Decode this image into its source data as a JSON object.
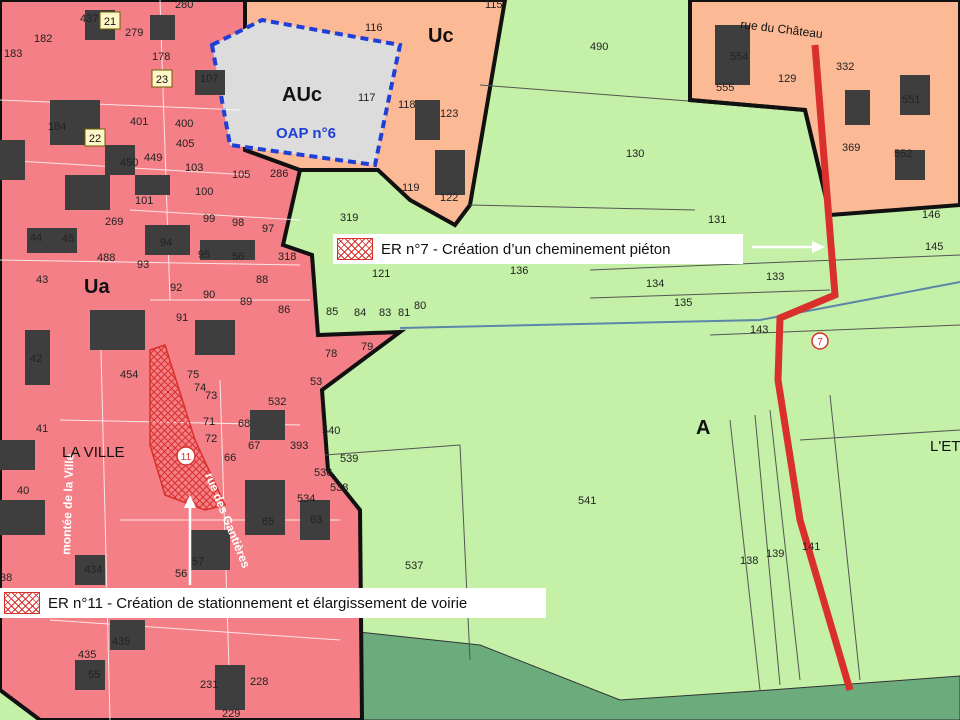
{
  "zones": {
    "ua": "Ua",
    "uc": "Uc",
    "auc": "AUc",
    "a": "A",
    "oap": "OAP n°6"
  },
  "streets": {
    "chateau": "rue du Château",
    "gantieres": "rue des Gantières",
    "montee": "montée de la Ville"
  },
  "places": {
    "la_ville": "LA VILLE",
    "etang": "L'ET"
  },
  "badges": [
    "21",
    "23",
    "22"
  ],
  "markers": {
    "er7": "7",
    "er11": "11"
  },
  "legend": {
    "er7": "ER n°7 - Création d’un cheminement piéton",
    "er11": "ER n°11 - Création de stationnement et élargissement de voirie"
  },
  "parcels": [
    "437",
    "279",
    "280",
    "182",
    "183",
    "178",
    "107",
    "116",
    "115",
    "490",
    "554",
    "129",
    "332",
    "555",
    "551",
    "369",
    "552",
    "184",
    "401",
    "400",
    "405",
    "117",
    "118",
    "123",
    "130",
    "449",
    "103",
    "450",
    "100",
    "105",
    "286",
    "119",
    "122",
    "101",
    "99",
    "98",
    "97",
    "131",
    "146",
    "145",
    "44",
    "45",
    "269",
    "94",
    "95",
    "56",
    "319",
    "136",
    "133",
    "43",
    "488",
    "93",
    "318",
    "88",
    "121",
    "134",
    "92",
    "90",
    "89",
    "86",
    "85",
    "84",
    "83",
    "81",
    "80",
    "135",
    "143",
    "91",
    "42",
    "454",
    "78",
    "79",
    "75",
    "74",
    "73",
    "532",
    "53",
    "68",
    "71",
    "72",
    "67",
    "66",
    "393",
    "41",
    "540",
    "539",
    "536",
    "534",
    "538",
    "40",
    "65",
    "63",
    "541",
    "537",
    "57",
    "56",
    "138",
    "139",
    "141",
    "434",
    "435",
    "55",
    "231",
    "228",
    "229",
    "38",
    "436",
    "435"
  ],
  "colors": {
    "urban": "#f47f86",
    "uc": "#fbb995",
    "auc": "#dcdcdc",
    "agri": "#c4f0a8",
    "forest": "#6bab7c",
    "building": "#3e3e3e",
    "er": "#d9302c",
    "oap": "#1f3fd6"
  }
}
